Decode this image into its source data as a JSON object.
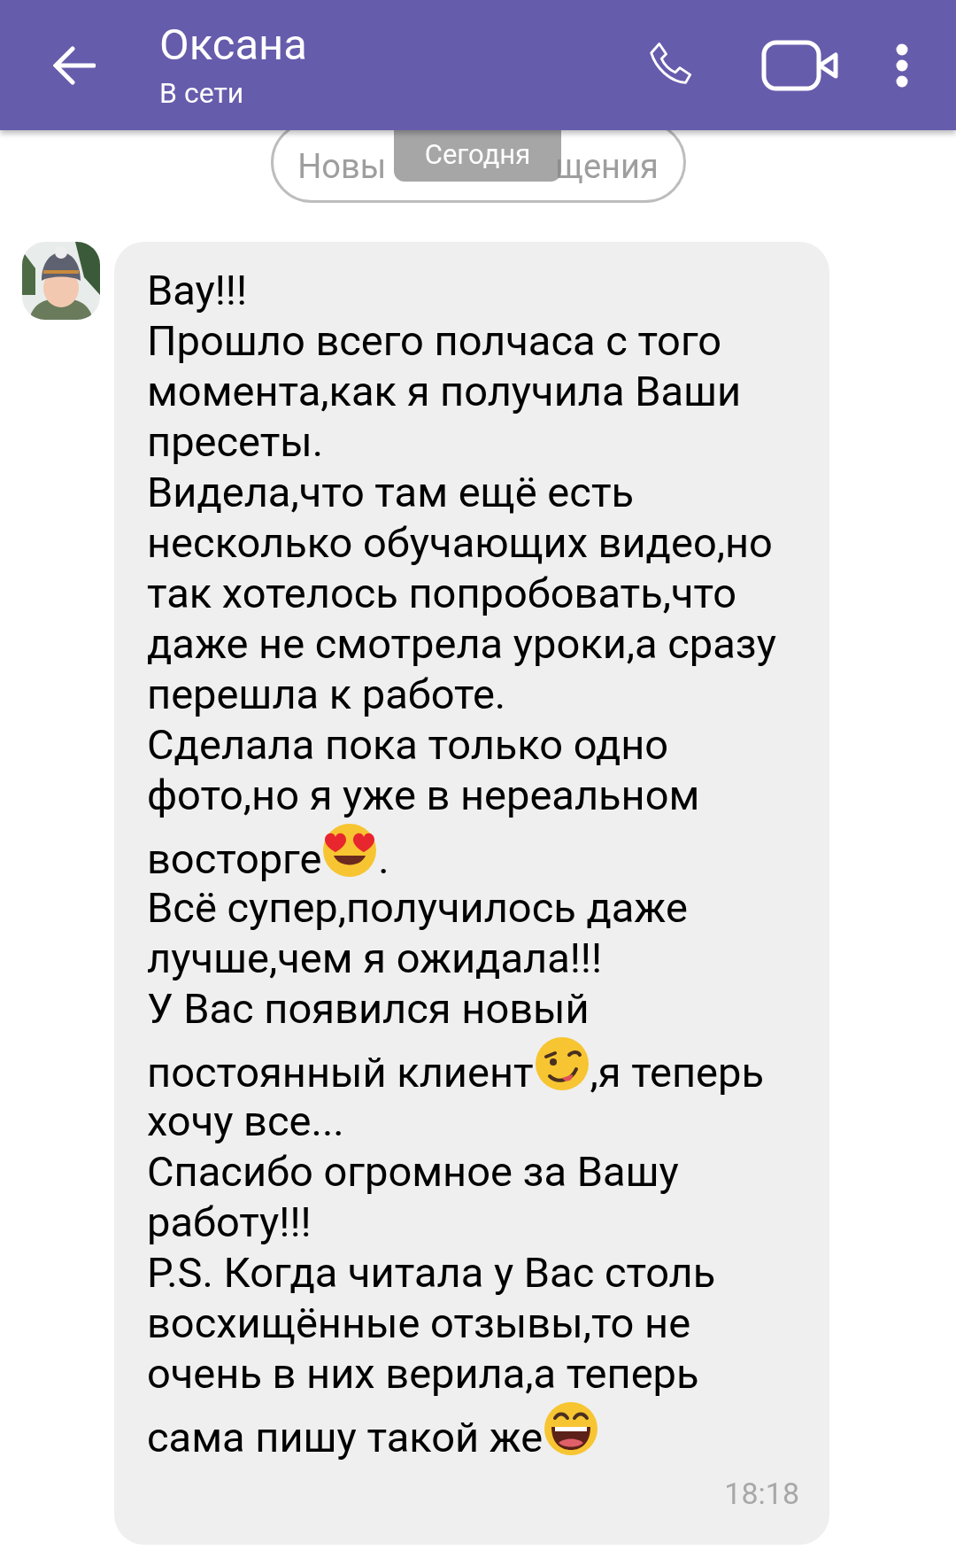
{
  "header": {
    "title": "Оксана",
    "status": "В сети"
  },
  "new_messages_pill": [
    "Новы",
    "щения"
  ],
  "date_badge": "Сегодня",
  "message": {
    "lines": [
      [
        {
          "kind": "text",
          "text": "Вау!!!"
        }
      ],
      [
        {
          "kind": "text",
          "text": "Прошло всего полчаса с того"
        }
      ],
      [
        {
          "kind": "text",
          "text": "момента,как я получила Ваши"
        }
      ],
      [
        {
          "kind": "text",
          "text": "пресеты."
        }
      ],
      [
        {
          "kind": "text",
          "text": "Видела,что там ещё есть"
        }
      ],
      [
        {
          "kind": "text",
          "text": "несколько обучающих видео,но"
        }
      ],
      [
        {
          "kind": "text",
          "text": "так хотелось попробовать,что"
        }
      ],
      [
        {
          "kind": "text",
          "text": "даже не смотрела уроки,а сразу"
        }
      ],
      [
        {
          "kind": "text",
          "text": "перешла к работе."
        }
      ],
      [
        {
          "kind": "text",
          "text": "Сделала пока только одно"
        }
      ],
      [
        {
          "kind": "text",
          "text": "фото,но я уже в нереальном"
        }
      ],
      [
        {
          "kind": "text",
          "text": "восторге"
        },
        {
          "kind": "heart-eyes"
        },
        {
          "kind": "text",
          "text": "."
        }
      ],
      [
        {
          "kind": "text",
          "text": "Всё супер,получилось даже"
        }
      ],
      [
        {
          "kind": "text",
          "text": "лучше,чем я ожидала!!!"
        }
      ],
      [
        {
          "kind": "text",
          "text": "У Вас появился новый"
        }
      ],
      [
        {
          "kind": "text",
          "text": "постоянный клиент"
        },
        {
          "kind": "wink"
        },
        {
          "kind": "text",
          "text": ",я теперь"
        }
      ],
      [
        {
          "kind": "text",
          "text": "хочу все..."
        }
      ],
      [
        {
          "kind": "text",
          "text": "Спасибо огромное за Вашу"
        }
      ],
      [
        {
          "kind": "text",
          "text": "работу!!!"
        }
      ],
      [
        {
          "kind": "text",
          "text": "P.S. Когда читала у Вас столь"
        }
      ],
      [
        {
          "kind": "text",
          "text": "восхищённые отзывы,то не"
        }
      ],
      [
        {
          "kind": "text",
          "text": "очень в них верила,а теперь"
        }
      ],
      [
        {
          "kind": "text",
          "text": "сама пишу такой же"
        },
        {
          "kind": "laugh"
        }
      ]
    ],
    "time": "18:18"
  }
}
